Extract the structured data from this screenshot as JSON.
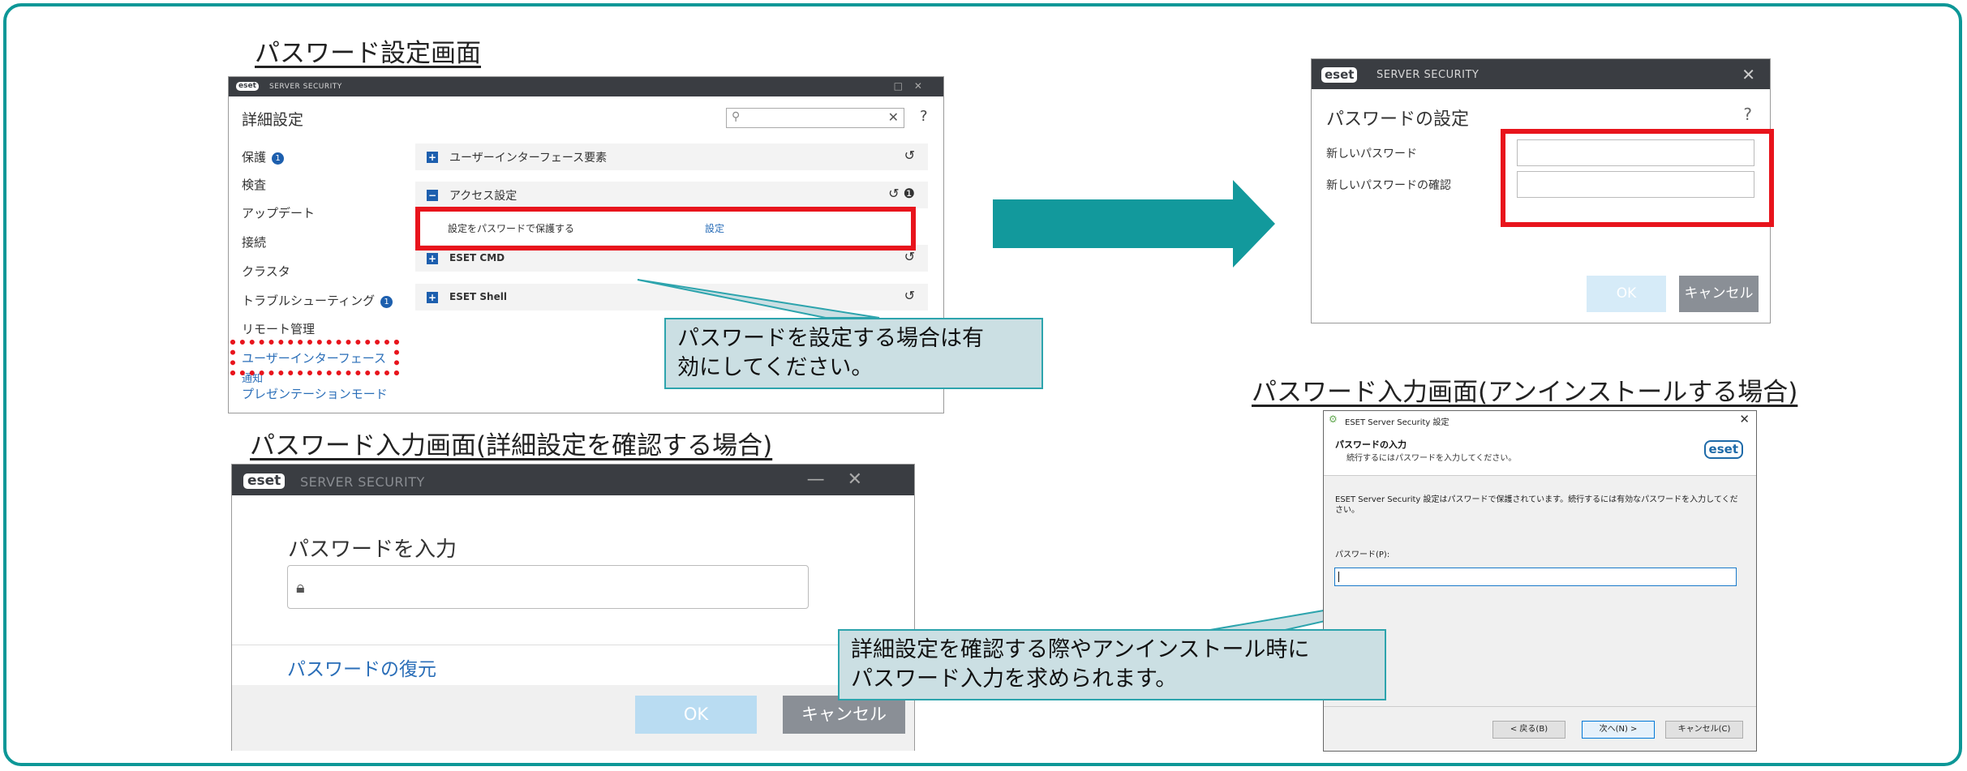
{
  "captions": {
    "settings_screen": "パスワード設定画面",
    "enter_advanced": "パスワード入力画面(詳細設定を確認する場合)",
    "enter_uninstall": "パスワード入力画面(アンインストールする場合)"
  },
  "advanced_window": {
    "brand": "eset",
    "product": "SERVER SECURITY",
    "heading": "詳細設定",
    "search_icon": "search-icon",
    "help": "?",
    "nav": [
      {
        "label": "保護",
        "badge": "1"
      },
      {
        "label": "検査"
      },
      {
        "label": "アップデート"
      },
      {
        "label": "接続"
      },
      {
        "label": "クラスタ"
      },
      {
        "label": "トラブルシューティング",
        "badge": "1"
      },
      {
        "label": "リモート管理"
      },
      {
        "label": "ユーザーインターフェース"
      },
      {
        "label": "通知"
      },
      {
        "label": "プレゼンテーションモード"
      }
    ],
    "sections": [
      {
        "label": "ユーザーインターフェース要素",
        "toggle": "+"
      },
      {
        "label": "アクセス設定",
        "toggle": "−"
      },
      {
        "label": "ESET CMD",
        "toggle": "+"
      },
      {
        "label": "ESET Shell",
        "toggle": "+"
      }
    ],
    "revert": "↺",
    "info": "❶",
    "protect_label": "設定をパスワードで保護する",
    "protect_link": "設定"
  },
  "set_password_window": {
    "brand": "eset",
    "product": "SERVER SECURITY",
    "close": "✕",
    "heading": "パスワードの設定",
    "help": "?",
    "new_password_label": "新しいパスワード",
    "confirm_password_label": "新しいパスワードの確認",
    "ok": "OK",
    "cancel": "キャンセル"
  },
  "enter_password_window": {
    "brand": "eset",
    "product": "SERVER SECURITY",
    "minimize": "—",
    "close": "✕",
    "heading": "パスワードを入力",
    "lock_icon": "lock-icon",
    "recover": "パスワードの復元",
    "ok": "OK",
    "cancel": "キャンセル"
  },
  "uninstall_window": {
    "title": "ESET Server Security 設定",
    "close": "✕",
    "header_title": "パスワードの入力",
    "header_sub": "続行するにはパスワードを入力してください。",
    "brand": "eset",
    "description": "ESET Server Security 設定はパスワードで保護されています。続行するには有効なパスワードを入力してください。",
    "password_label": "パスワード(P):",
    "back": "< 戻る(B)",
    "next": "次へ(N) >",
    "cancel": "キャンセル(C)"
  },
  "callouts": {
    "set_password": "パスワードを設定する場合は有\n効にしてください。",
    "enter_password": "詳細設定を確認する際やアンインストール時に\nパスワード入力を求められます。"
  },
  "colors": {
    "frame": "#0d9797",
    "arrow": "#12999c",
    "highlight": "#e8141c",
    "callout_fill": "#cbdfe3",
    "eset_dark": "#3a3d42",
    "link": "#2a6eb8"
  }
}
